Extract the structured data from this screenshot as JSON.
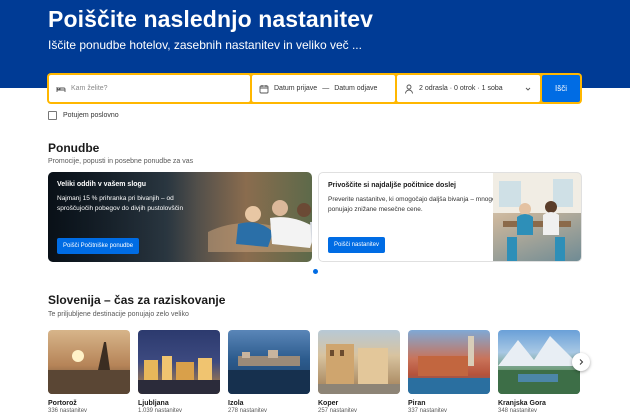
{
  "hero": {
    "title": "Poiščite naslednjo nastanitev",
    "subtitle": "Iščite ponudbe hotelov, zasebnih nastanitev in veliko več ..."
  },
  "search": {
    "destination_placeholder": "Kam želite?",
    "checkin": "Datum prijave",
    "dash": "—",
    "checkout": "Datum odjave",
    "guests": "2 odrasla · 0 otrok · 1 soba",
    "button": "Išči"
  },
  "business_label": "Potujem poslovno",
  "offers": {
    "title": "Ponudbe",
    "subtitle": "Promocije, popusti in posebne ponudbe za vas",
    "cards": [
      {
        "title": "Veliki oddih v vašem slogu",
        "desc": "Najmanj 15 % prihranka pri bivanjih – od sproščujočih pobegov do divjih pustolovščin",
        "button": "Poišči Počitniške ponudbe"
      },
      {
        "title": "Privoščite si najdaljše počitnice doslej",
        "desc": "Preverite nastanitve, ki omogočajo daljša bivanja – mnoge ponujajo znižane mesečne cene.",
        "button": "Poišči nastanitev"
      }
    ]
  },
  "slovenia": {
    "title": "Slovenija – čas za raziskovanje",
    "subtitle": "Te priljubljene destinacije ponujajo zelo veliko",
    "destinations": [
      {
        "name": "Portorož",
        "count": "336 nastanitev"
      },
      {
        "name": "Ljubljana",
        "count": "1.039 nastanitev"
      },
      {
        "name": "Izola",
        "count": "278 nastanitev"
      },
      {
        "name": "Koper",
        "count": "257 nastanitev"
      },
      {
        "name": "Piran",
        "count": "337 nastanitev"
      },
      {
        "name": "Kranjska Gora",
        "count": "348 nastanitev"
      }
    ]
  },
  "colors": {
    "brand": "#003b95",
    "accent": "#006ce4",
    "search_border": "#ffb700"
  },
  "icons": {
    "calendar": "calendar-icon",
    "person": "person-icon",
    "chevron": "chevron-down-icon",
    "next": "chevron-right-icon"
  }
}
